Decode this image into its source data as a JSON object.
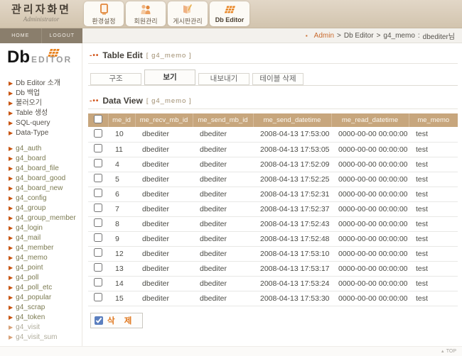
{
  "header": {
    "title": "관리자화면",
    "subtitle": "Administrator",
    "home_label": "HOME",
    "logout_label": "LOGOUT",
    "nav": [
      {
        "id": "config",
        "label": "환경설정",
        "icon": "monitor-icon",
        "active": false
      },
      {
        "id": "members",
        "label": "회원관리",
        "icon": "members-icon",
        "active": false
      },
      {
        "id": "boards",
        "label": "게시판관리",
        "icon": "book-icon",
        "active": false
      },
      {
        "id": "db-editor",
        "label": "Db Editor",
        "icon": "db-grid-icon",
        "active": true
      }
    ]
  },
  "breadcrumb": {
    "bullet": "▪",
    "admin": "Admin",
    "separator": ">",
    "app": "Db Editor",
    "table_name": "g4_memo",
    "colon": ":",
    "user": "dbediter님"
  },
  "sidebar": {
    "logo_db": "Db",
    "logo_editor": "EDITOR",
    "arrow": "▶",
    "menu_main": [
      {
        "id": "db-editor-intro",
        "label": "Db Editor 소개"
      },
      {
        "id": "db-backup",
        "label": "Db 백업"
      },
      {
        "id": "db-restore",
        "label": "불러오기"
      },
      {
        "id": "table-create",
        "label": "Table 생성"
      },
      {
        "id": "sql-query",
        "label": "SQL-query"
      },
      {
        "id": "data-type",
        "label": "Data-Type"
      }
    ],
    "tables": [
      "g4_auth",
      "g4_board",
      "g4_board_file",
      "g4_board_good",
      "g4_board_new",
      "g4_config",
      "g4_group",
      "g4_group_member",
      "g4_login",
      "g4_mail",
      "g4_member",
      "g4_memo",
      "g4_point",
      "g4_poll",
      "g4_poll_etc",
      "g4_popular",
      "g4_scrap",
      "g4_token",
      "g4_visit",
      "g4_visit_sum"
    ],
    "muted_tables": [
      "g4_visit",
      "g4_visit_sum"
    ]
  },
  "table_edit": {
    "section_bullet": "-••",
    "title": "Table Edit",
    "table_ref": "[ g4_memo ]",
    "buttons": [
      {
        "id": "structure",
        "label": "구조",
        "active": false
      },
      {
        "id": "view",
        "label": "보기",
        "active": true
      },
      {
        "id": "export",
        "label": "내보내기",
        "active": false
      },
      {
        "id": "drop",
        "label": "테이블 삭제",
        "active": false
      }
    ]
  },
  "data_view": {
    "section_bullet": "-••",
    "title": "Data View",
    "table_ref": "[ g4_memo ]",
    "columns": [
      "me_id",
      "me_recv_mb_id",
      "me_send_mb_id",
      "me_send_datetime",
      "me_read_datetime",
      "me_memo"
    ],
    "rows": [
      {
        "me_id": "10",
        "me_recv_mb_id": "dbediter",
        "me_send_mb_id": "dbediter",
        "me_send_datetime": "2008-04-13 17:53:00",
        "me_read_datetime": "0000-00-00 00:00:00",
        "me_memo": "test"
      },
      {
        "me_id": "11",
        "me_recv_mb_id": "dbediter",
        "me_send_mb_id": "dbediter",
        "me_send_datetime": "2008-04-13 17:53:05",
        "me_read_datetime": "0000-00-00 00:00:00",
        "me_memo": "test"
      },
      {
        "me_id": "4",
        "me_recv_mb_id": "dbediter",
        "me_send_mb_id": "dbediter",
        "me_send_datetime": "2008-04-13 17:52:09",
        "me_read_datetime": "0000-00-00 00:00:00",
        "me_memo": "test"
      },
      {
        "me_id": "5",
        "me_recv_mb_id": "dbediter",
        "me_send_mb_id": "dbediter",
        "me_send_datetime": "2008-04-13 17:52:25",
        "me_read_datetime": "0000-00-00 00:00:00",
        "me_memo": "test"
      },
      {
        "me_id": "6",
        "me_recv_mb_id": "dbediter",
        "me_send_mb_id": "dbediter",
        "me_send_datetime": "2008-04-13 17:52:31",
        "me_read_datetime": "0000-00-00 00:00:00",
        "me_memo": "test"
      },
      {
        "me_id": "7",
        "me_recv_mb_id": "dbediter",
        "me_send_mb_id": "dbediter",
        "me_send_datetime": "2008-04-13 17:52:37",
        "me_read_datetime": "0000-00-00 00:00:00",
        "me_memo": "test"
      },
      {
        "me_id": "8",
        "me_recv_mb_id": "dbediter",
        "me_send_mb_id": "dbediter",
        "me_send_datetime": "2008-04-13 17:52:43",
        "me_read_datetime": "0000-00-00 00:00:00",
        "me_memo": "test"
      },
      {
        "me_id": "9",
        "me_recv_mb_id": "dbediter",
        "me_send_mb_id": "dbediter",
        "me_send_datetime": "2008-04-13 17:52:48",
        "me_read_datetime": "0000-00-00 00:00:00",
        "me_memo": "test"
      },
      {
        "me_id": "12",
        "me_recv_mb_id": "dbediter",
        "me_send_mb_id": "dbediter",
        "me_send_datetime": "2008-04-13 17:53:10",
        "me_read_datetime": "0000-00-00 00:00:00",
        "me_memo": "test"
      },
      {
        "me_id": "13",
        "me_recv_mb_id": "dbediter",
        "me_send_mb_id": "dbediter",
        "me_send_datetime": "2008-04-13 17:53:17",
        "me_read_datetime": "0000-00-00 00:00:00",
        "me_memo": "test"
      },
      {
        "me_id": "14",
        "me_recv_mb_id": "dbediter",
        "me_send_mb_id": "dbediter",
        "me_send_datetime": "2008-04-13 17:53:24",
        "me_read_datetime": "0000-00-00 00:00:00",
        "me_memo": "test"
      },
      {
        "me_id": "15",
        "me_recv_mb_id": "dbediter",
        "me_send_mb_id": "dbediter",
        "me_send_datetime": "2008-04-13 17:53:30",
        "me_read_datetime": "0000-00-00 00:00:00",
        "me_memo": "test"
      }
    ],
    "delete_label": "삭 제"
  },
  "footer": {
    "arrow": "▲",
    "top_label": "TOP"
  },
  "colors": {
    "header_bg": "#D8CCBA",
    "bar_bg": "#8A7E6C",
    "accent_orange": "#E8821E",
    "breadcrumb_accent": "#C96B2F",
    "table_header_bg": "#C7A67D",
    "table_link_olive": "#7C7B52",
    "muted_item": "#AFAC9B",
    "delete_text": "#E0761C"
  }
}
